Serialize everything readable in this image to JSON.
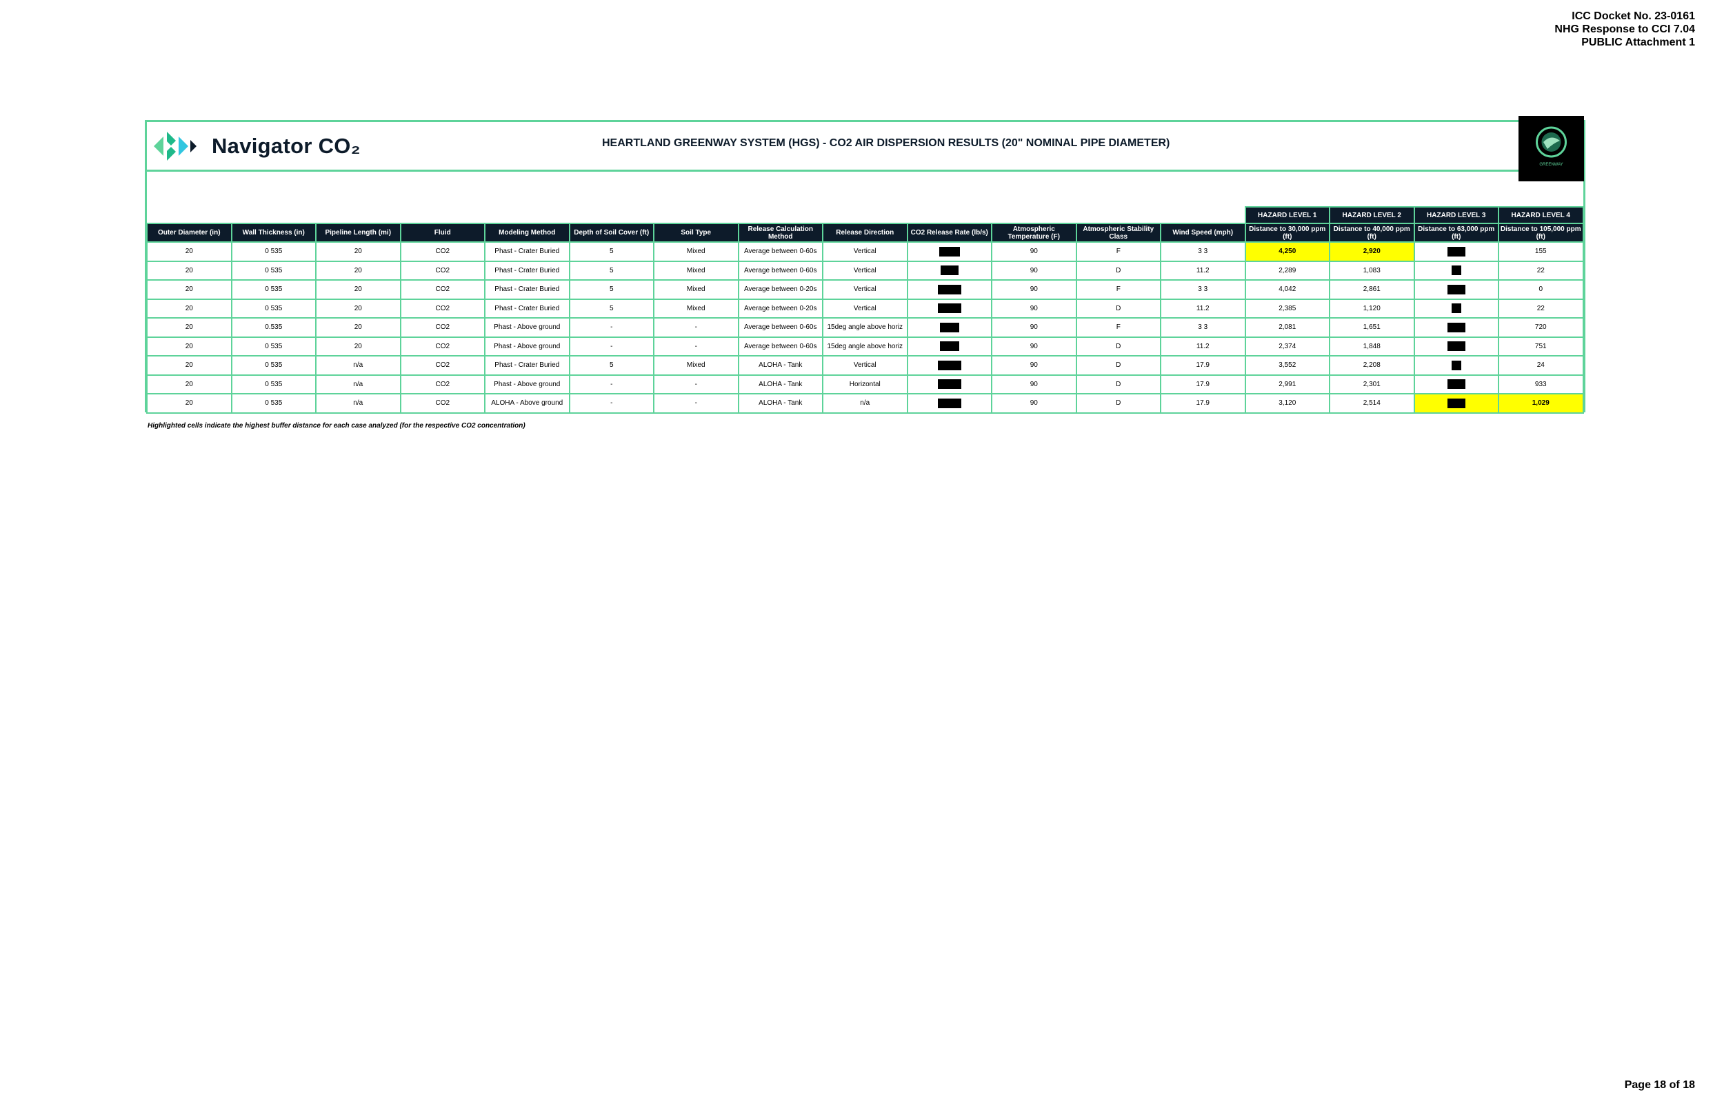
{
  "docket": {
    "line1": "ICC Docket No. 23-0161",
    "line2": "NHG Response to CCI 7.04",
    "line3": "PUBLIC Attachment 1"
  },
  "header": {
    "logo_text": "Navigator CO₂",
    "title": "HEARTLAND GREENWAY SYSTEM (HGS) - CO2 AIR DISPERSION RESULTS (20\" NOMINAL PIPE DIAMETER)",
    "badge_text": "GREENWAY"
  },
  "hazard_levels": [
    "HAZARD LEVEL 1",
    "HAZARD LEVEL 2",
    "HAZARD LEVEL 3",
    "HAZARD LEVEL 4"
  ],
  "columns": [
    "Outer Diameter (in)",
    "Wall Thickness (in)",
    "Pipeline Length (mi)",
    "Fluid",
    "Modeling Method",
    "Depth of Soil Cover (ft)",
    "Soil Type",
    "Release Calculation Method",
    "Release Direction",
    "CO2 Release Rate (lb/s)",
    "Atmospheric Temperature (F)",
    "Atmospheric Stability Class",
    "Wind Speed (mph)",
    "Distance to 30,000 ppm (ft)",
    "Distance to 40,000 ppm (ft)",
    "Distance to 63,000 ppm (ft)",
    "Distance to 105,000 ppm (ft)"
  ],
  "rows": [
    [
      "20",
      "0 535",
      "20",
      "CO2",
      "Phast - Crater Buried",
      "5",
      "Mixed",
      "Average between 0-60s",
      "Vertical",
      "",
      "90",
      "F",
      "3 3",
      "4,250",
      "2,920",
      "",
      "155"
    ],
    [
      "20",
      "0 535",
      "20",
      "CO2",
      "Phast - Crater Buried",
      "5",
      "Mixed",
      "Average between 0-60s",
      "Vertical",
      "",
      "90",
      "D",
      "11.2",
      "2,289",
      "1,083",
      "",
      "22"
    ],
    [
      "20",
      "0 535",
      "20",
      "CO2",
      "Phast - Crater Buried",
      "5",
      "Mixed",
      "Average between 0-20s",
      "Vertical",
      "",
      "90",
      "F",
      "3 3",
      "4,042",
      "2,861",
      "",
      "0"
    ],
    [
      "20",
      "0 535",
      "20",
      "CO2",
      "Phast - Crater Buried",
      "5",
      "Mixed",
      "Average between 0-20s",
      "Vertical",
      "",
      "90",
      "D",
      "11.2",
      "2,385",
      "1,120",
      "",
      "22"
    ],
    [
      "20",
      "0.535",
      "20",
      "CO2",
      "Phast - Above ground",
      "-",
      "-",
      "Average between 0-60s",
      "15deg angle above horiz",
      "",
      "90",
      "F",
      "3 3",
      "2,081",
      "1,651",
      "",
      "720"
    ],
    [
      "20",
      "0 535",
      "20",
      "CO2",
      "Phast - Above ground",
      "-",
      "-",
      "Average between 0-60s",
      "15deg angle above horiz",
      "",
      "90",
      "D",
      "11.2",
      "2,374",
      "1,848",
      "",
      "751"
    ],
    [
      "20",
      "0 535",
      "n/a",
      "CO2",
      "Phast - Crater Buried",
      "5",
      "Mixed",
      "ALOHA - Tank",
      "Vertical",
      "",
      "90",
      "D",
      "17.9",
      "3,552",
      "2,208",
      "",
      "24"
    ],
    [
      "20",
      "0 535",
      "n/a",
      "CO2",
      "Phast - Above ground",
      "-",
      "-",
      "ALOHA - Tank",
      "Horizontal",
      "",
      "90",
      "D",
      "17.9",
      "2,991",
      "2,301",
      "",
      "933"
    ],
    [
      "20",
      "0 535",
      "n/a",
      "CO2",
      "ALOHA - Above ground",
      "-",
      "-",
      "ALOHA - Tank",
      "n/a",
      "",
      "90",
      "D",
      "17.9",
      "3,120",
      "2,514",
      "",
      "1,029"
    ]
  ],
  "highlight_color": "#ffff00",
  "accent_color": "#5ed39a",
  "header_color": "#0d1b2a",
  "footnote": "Highlighted cells indicate the highest buffer distance for each case analyzed (for the respective CO2 concentration)",
  "page": "Page 18 of 18"
}
